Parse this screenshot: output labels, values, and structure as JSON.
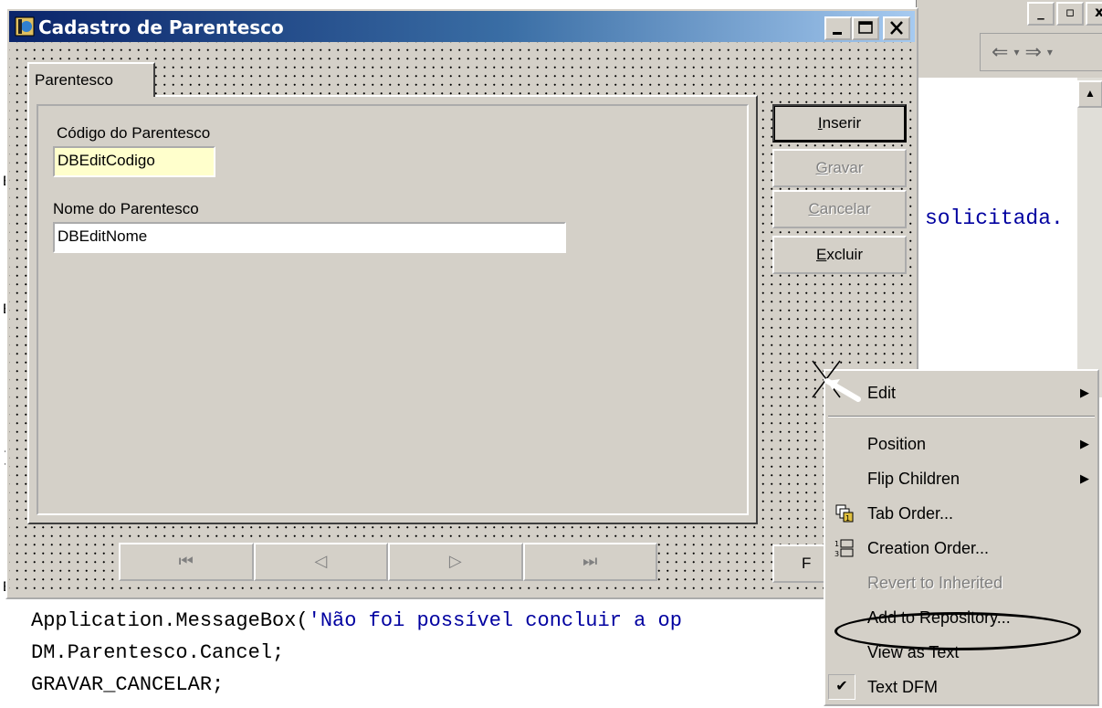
{
  "form": {
    "title": "Cadastro de Parentesco",
    "tab_label": "Parentesco",
    "codigo_label": "Código do Parentesco",
    "codigo_value": "DBEditCodigo",
    "nome_label": "Nome do Parentesco",
    "nome_value": "DBEditNome",
    "buttons": {
      "inserir": {
        "underline": "I",
        "rest": "nserir"
      },
      "gravar": {
        "underline": "G",
        "rest": "ravar"
      },
      "cancelar": {
        "underline": "C",
        "rest": "ancelar"
      },
      "excluir": {
        "underline": "E",
        "rest": "xcluir"
      }
    },
    "navigator": {
      "first": "⏮",
      "prior": "◁",
      "next": "▷",
      "last": "⏭"
    },
    "partial_button": "F",
    "window_buttons": {
      "minimize": "_",
      "maximize": "□",
      "close": "✕"
    }
  },
  "editor": {
    "right_text": "solicitada.",
    "code_line_1_prefix": "Application.MessageBox(",
    "code_line_1_string": "'Não foi possível concluir a op",
    "code_line_2": "DM.Parentesco.Cancel;",
    "code_line_3": "GRAVAR_CANCELAR;",
    "gutter_char": "E"
  },
  "context_menu": {
    "items": [
      {
        "label": "Edit",
        "submenu": true,
        "disabled": false
      },
      {
        "label": "Position",
        "submenu": true,
        "disabled": false
      },
      {
        "label": "Flip Children",
        "submenu": true,
        "disabled": false
      },
      {
        "label": "Tab Order...",
        "submenu": false,
        "disabled": false,
        "icon": "tab-order-icon"
      },
      {
        "label": "Creation Order...",
        "submenu": false,
        "disabled": false,
        "icon": "creation-order-icon"
      },
      {
        "label": "Revert to Inherited",
        "submenu": false,
        "disabled": true
      },
      {
        "label": "Add to Repository...",
        "submenu": false,
        "disabled": false
      },
      {
        "label": "View as Text",
        "submenu": false,
        "disabled": false
      },
      {
        "label": "Text DFM",
        "submenu": false,
        "disabled": false,
        "checked": true
      }
    ]
  },
  "colors": {
    "titlebar_start": "#0a246a",
    "titlebar_end": "#a6caf0",
    "face": "#d4d0c8",
    "string_blue": "#0000a0",
    "edit_yellow": "#ffffcc"
  }
}
